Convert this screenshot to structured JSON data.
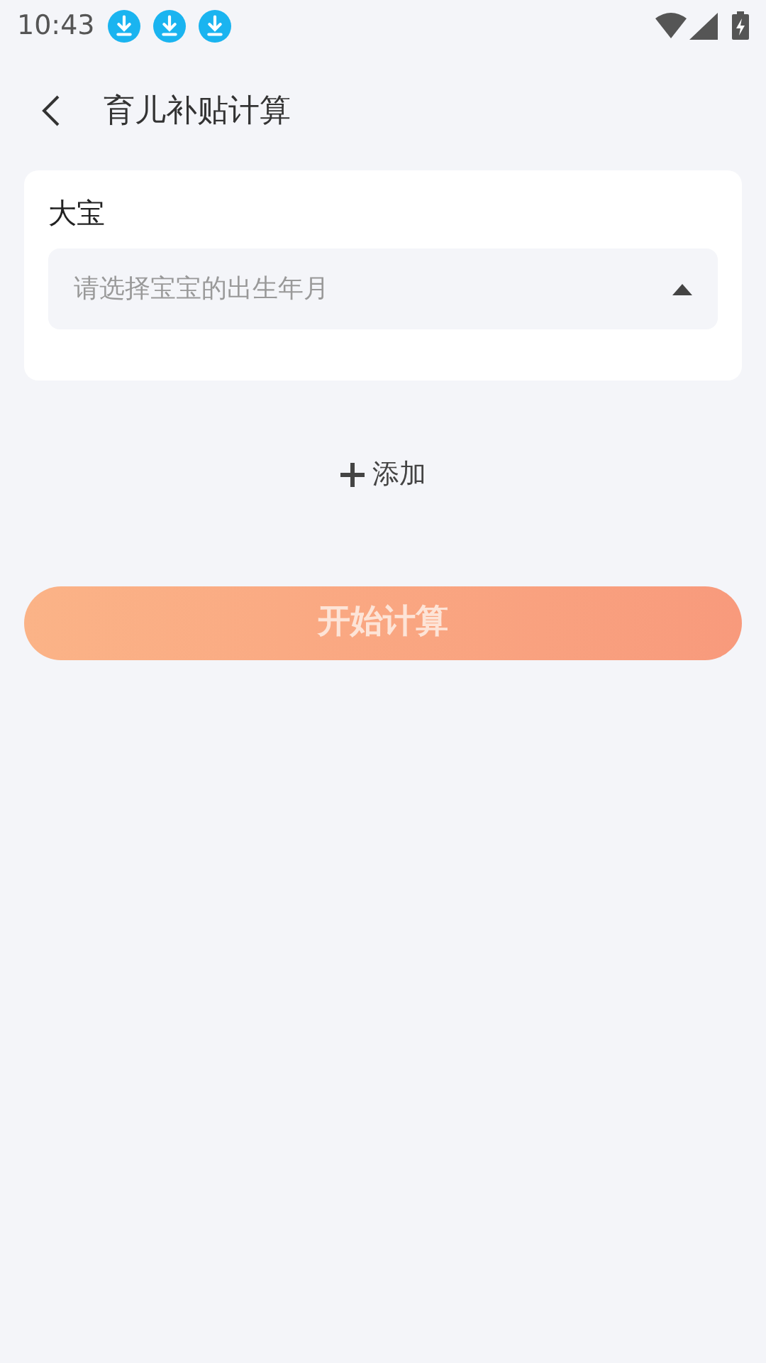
{
  "status_bar": {
    "time": "10:43",
    "notifications": [
      {
        "kind": "download"
      },
      {
        "kind": "download"
      },
      {
        "kind": "download"
      }
    ]
  },
  "header": {
    "title": "育儿补贴计算"
  },
  "children": [
    {
      "label": "大宝",
      "select": {
        "placeholder": "请选择宝宝的出生年月",
        "expanded": true
      }
    }
  ],
  "add_button": {
    "label": "添加"
  },
  "calculate_button": {
    "label": "开始计算",
    "disabled": true
  }
}
